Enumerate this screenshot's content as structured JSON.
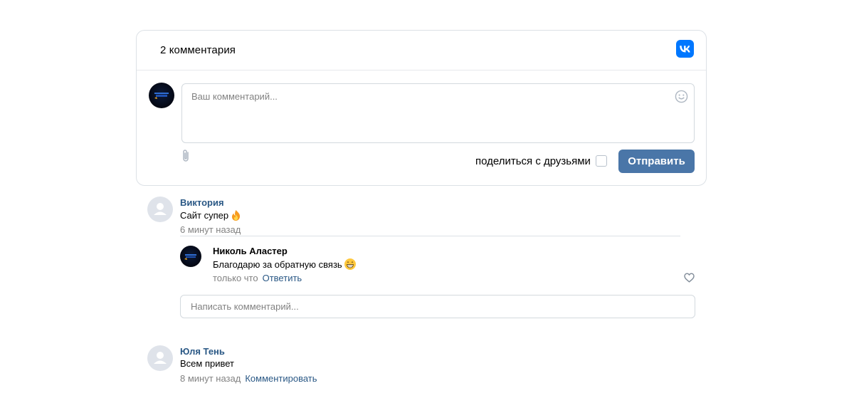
{
  "widget": {
    "comment_count": "2 комментария",
    "logo_icon": "vk-logo-icon",
    "brand_color": "#0077ff"
  },
  "composer": {
    "placeholder": "Ваш комментарий...",
    "emoji_icon": "smile-icon",
    "attach_icon": "paperclip-icon",
    "share_label": "поделиться с друзьями",
    "share_checked": false,
    "send_label": "Отправить",
    "send_color": "#4a76a8"
  },
  "comments": [
    {
      "author": "Виктория",
      "text": "Сайт супер",
      "emoji": "fire",
      "time": "6 минут назад",
      "replies": [
        {
          "author": "Николь Аластер",
          "text": "Благодарю за обратную связь",
          "emoji": "grinning",
          "time": "только что",
          "reply_label": "Ответить",
          "like_icon": "heart-icon"
        }
      ],
      "reply_placeholder": "Написать комментарий..."
    },
    {
      "author": "Юля Тень",
      "text": "Всем привет",
      "time": "8 минут назад",
      "action_label": "Комментировать"
    }
  ],
  "colors": {
    "link": "#2a5885",
    "meta": "#828282",
    "border": "#dce1e6"
  }
}
